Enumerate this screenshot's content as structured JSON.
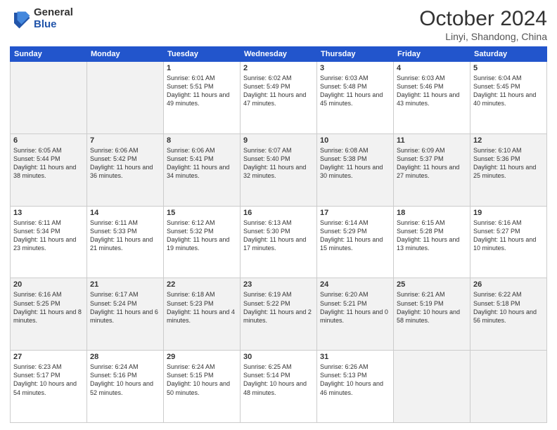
{
  "logo": {
    "general": "General",
    "blue": "Blue"
  },
  "header": {
    "month": "October 2024",
    "location": "Linyi, Shandong, China"
  },
  "weekdays": [
    "Sunday",
    "Monday",
    "Tuesday",
    "Wednesday",
    "Thursday",
    "Friday",
    "Saturday"
  ],
  "weeks": [
    [
      {
        "day": "",
        "info": ""
      },
      {
        "day": "",
        "info": ""
      },
      {
        "day": "1",
        "info": "Sunrise: 6:01 AM\nSunset: 5:51 PM\nDaylight: 11 hours and 49 minutes."
      },
      {
        "day": "2",
        "info": "Sunrise: 6:02 AM\nSunset: 5:49 PM\nDaylight: 11 hours and 47 minutes."
      },
      {
        "day": "3",
        "info": "Sunrise: 6:03 AM\nSunset: 5:48 PM\nDaylight: 11 hours and 45 minutes."
      },
      {
        "day": "4",
        "info": "Sunrise: 6:03 AM\nSunset: 5:46 PM\nDaylight: 11 hours and 43 minutes."
      },
      {
        "day": "5",
        "info": "Sunrise: 6:04 AM\nSunset: 5:45 PM\nDaylight: 11 hours and 40 minutes."
      }
    ],
    [
      {
        "day": "6",
        "info": "Sunrise: 6:05 AM\nSunset: 5:44 PM\nDaylight: 11 hours and 38 minutes."
      },
      {
        "day": "7",
        "info": "Sunrise: 6:06 AM\nSunset: 5:42 PM\nDaylight: 11 hours and 36 minutes."
      },
      {
        "day": "8",
        "info": "Sunrise: 6:06 AM\nSunset: 5:41 PM\nDaylight: 11 hours and 34 minutes."
      },
      {
        "day": "9",
        "info": "Sunrise: 6:07 AM\nSunset: 5:40 PM\nDaylight: 11 hours and 32 minutes."
      },
      {
        "day": "10",
        "info": "Sunrise: 6:08 AM\nSunset: 5:38 PM\nDaylight: 11 hours and 30 minutes."
      },
      {
        "day": "11",
        "info": "Sunrise: 6:09 AM\nSunset: 5:37 PM\nDaylight: 11 hours and 27 minutes."
      },
      {
        "day": "12",
        "info": "Sunrise: 6:10 AM\nSunset: 5:36 PM\nDaylight: 11 hours and 25 minutes."
      }
    ],
    [
      {
        "day": "13",
        "info": "Sunrise: 6:11 AM\nSunset: 5:34 PM\nDaylight: 11 hours and 23 minutes."
      },
      {
        "day": "14",
        "info": "Sunrise: 6:11 AM\nSunset: 5:33 PM\nDaylight: 11 hours and 21 minutes."
      },
      {
        "day": "15",
        "info": "Sunrise: 6:12 AM\nSunset: 5:32 PM\nDaylight: 11 hours and 19 minutes."
      },
      {
        "day": "16",
        "info": "Sunrise: 6:13 AM\nSunset: 5:30 PM\nDaylight: 11 hours and 17 minutes."
      },
      {
        "day": "17",
        "info": "Sunrise: 6:14 AM\nSunset: 5:29 PM\nDaylight: 11 hours and 15 minutes."
      },
      {
        "day": "18",
        "info": "Sunrise: 6:15 AM\nSunset: 5:28 PM\nDaylight: 11 hours and 13 minutes."
      },
      {
        "day": "19",
        "info": "Sunrise: 6:16 AM\nSunset: 5:27 PM\nDaylight: 11 hours and 10 minutes."
      }
    ],
    [
      {
        "day": "20",
        "info": "Sunrise: 6:16 AM\nSunset: 5:25 PM\nDaylight: 11 hours and 8 minutes."
      },
      {
        "day": "21",
        "info": "Sunrise: 6:17 AM\nSunset: 5:24 PM\nDaylight: 11 hours and 6 minutes."
      },
      {
        "day": "22",
        "info": "Sunrise: 6:18 AM\nSunset: 5:23 PM\nDaylight: 11 hours and 4 minutes."
      },
      {
        "day": "23",
        "info": "Sunrise: 6:19 AM\nSunset: 5:22 PM\nDaylight: 11 hours and 2 minutes."
      },
      {
        "day": "24",
        "info": "Sunrise: 6:20 AM\nSunset: 5:21 PM\nDaylight: 11 hours and 0 minutes."
      },
      {
        "day": "25",
        "info": "Sunrise: 6:21 AM\nSunset: 5:19 PM\nDaylight: 10 hours and 58 minutes."
      },
      {
        "day": "26",
        "info": "Sunrise: 6:22 AM\nSunset: 5:18 PM\nDaylight: 10 hours and 56 minutes."
      }
    ],
    [
      {
        "day": "27",
        "info": "Sunrise: 6:23 AM\nSunset: 5:17 PM\nDaylight: 10 hours and 54 minutes."
      },
      {
        "day": "28",
        "info": "Sunrise: 6:24 AM\nSunset: 5:16 PM\nDaylight: 10 hours and 52 minutes."
      },
      {
        "day": "29",
        "info": "Sunrise: 6:24 AM\nSunset: 5:15 PM\nDaylight: 10 hours and 50 minutes."
      },
      {
        "day": "30",
        "info": "Sunrise: 6:25 AM\nSunset: 5:14 PM\nDaylight: 10 hours and 48 minutes."
      },
      {
        "day": "31",
        "info": "Sunrise: 6:26 AM\nSunset: 5:13 PM\nDaylight: 10 hours and 46 minutes."
      },
      {
        "day": "",
        "info": ""
      },
      {
        "day": "",
        "info": ""
      }
    ]
  ]
}
